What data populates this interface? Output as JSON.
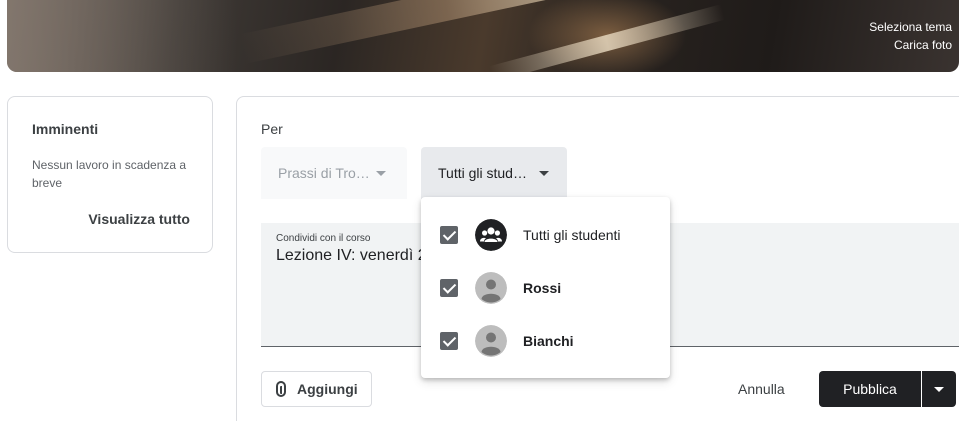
{
  "banner": {
    "select_theme": "Seleziona tema",
    "upload_photo": "Carica foto"
  },
  "upcoming": {
    "title": "Imminenti",
    "description": "Nessun lavoro in scadenza a breve",
    "view_all": "Visualizza tutto"
  },
  "composer": {
    "for_label": "Per",
    "course_select": "Prassi di Tro…",
    "students_select": "Tutti gli stud…",
    "share_label": "Condividi con il corso",
    "share_value": "Lezione IV: venerdì 2",
    "add_button": "Aggiungi",
    "cancel_button": "Annulla",
    "publish_button": "Pubblica"
  },
  "students_menu": {
    "items": [
      {
        "label": "Tutti gli studenti",
        "checked": true,
        "icon": "group-icon"
      },
      {
        "label": "Rossi",
        "checked": true,
        "icon": "person-avatar-icon"
      },
      {
        "label": "Bianchi",
        "checked": true,
        "icon": "person-avatar-icon"
      }
    ]
  },
  "colors": {
    "primary_button": "#202124",
    "field_background": "#f1f3f4",
    "border": "#dadce0"
  }
}
